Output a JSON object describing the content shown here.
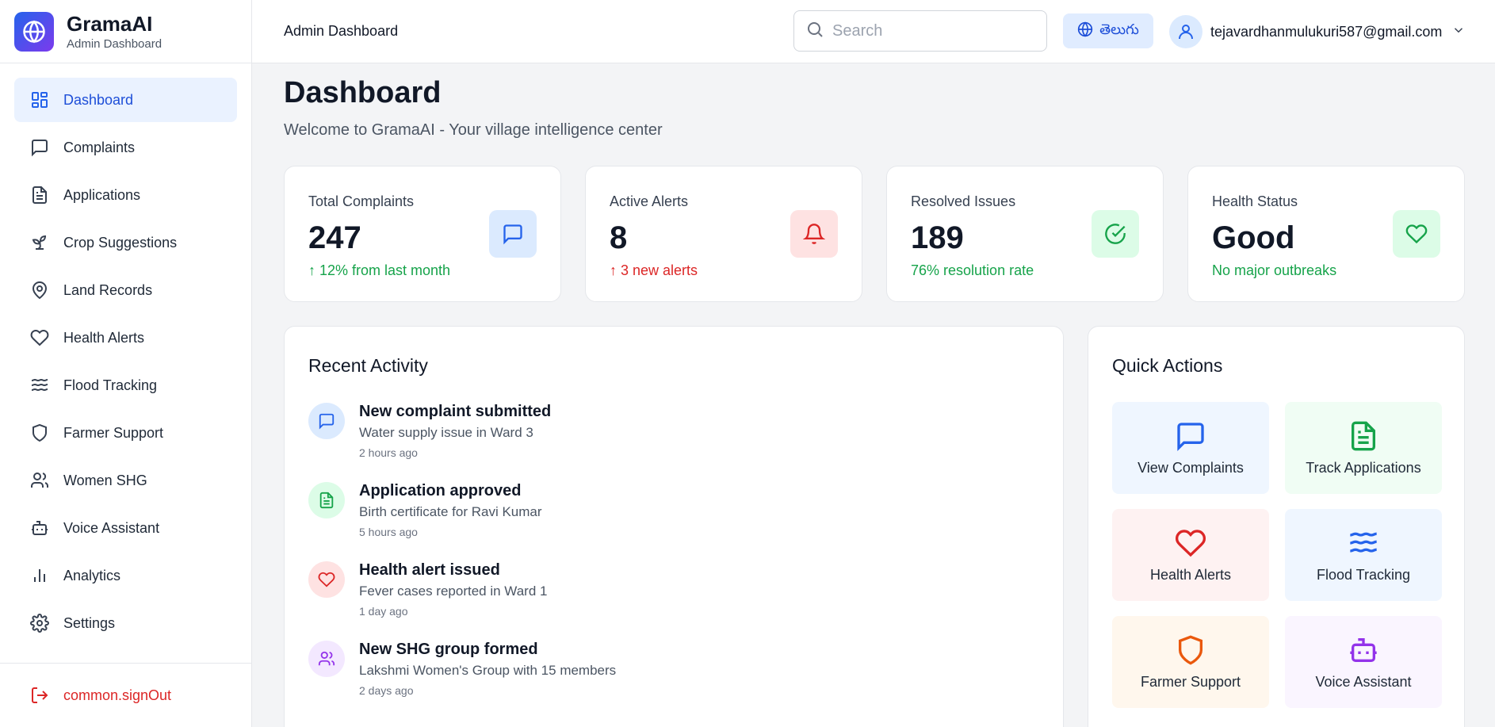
{
  "brand": {
    "name": "GramaAI",
    "subtitle": "Admin Dashboard"
  },
  "sidebar": {
    "items": [
      {
        "label": "Dashboard",
        "icon": "layout-grid-icon",
        "active": true
      },
      {
        "label": "Complaints",
        "icon": "message-square-icon"
      },
      {
        "label": "Applications",
        "icon": "file-text-icon"
      },
      {
        "label": "Crop Suggestions",
        "icon": "sprout-icon"
      },
      {
        "label": "Land Records",
        "icon": "map-pin-icon"
      },
      {
        "label": "Health Alerts",
        "icon": "heart-icon"
      },
      {
        "label": "Flood Tracking",
        "icon": "waves-icon"
      },
      {
        "label": "Farmer Support",
        "icon": "shield-icon"
      },
      {
        "label": "Women SHG",
        "icon": "users-icon"
      },
      {
        "label": "Voice Assistant",
        "icon": "bot-icon"
      },
      {
        "label": "Analytics",
        "icon": "bar-chart-icon"
      },
      {
        "label": "Settings",
        "icon": "gear-icon"
      }
    ],
    "signout_label": "common.signOut"
  },
  "header": {
    "title": "Admin Dashboard",
    "search_placeholder": "Search",
    "language": "తెలుగు",
    "user_email": "tejavardhanmulukuri587@gmail.com"
  },
  "main": {
    "title": "Dashboard",
    "subtitle": "Welcome to GramaAI - Your village intelligence center"
  },
  "stats": [
    {
      "label": "Total Complaints",
      "value": "247",
      "note": "↑ 12% from last month",
      "note_color": "#16a34a",
      "icon": "message-square-icon",
      "icon_bg": "#dbeafe",
      "icon_color": "#2563eb"
    },
    {
      "label": "Active Alerts",
      "value": "8",
      "note": "↑ 3 new alerts",
      "note_color": "#dc2626",
      "icon": "bell-icon",
      "icon_bg": "#fee2e2",
      "icon_color": "#dc2626"
    },
    {
      "label": "Resolved Issues",
      "value": "189",
      "note": "76% resolution rate",
      "note_color": "#16a34a",
      "icon": "check-circle-icon",
      "icon_bg": "#dcfce7",
      "icon_color": "#16a34a"
    },
    {
      "label": "Health Status",
      "value": "Good",
      "note": "No major outbreaks",
      "note_color": "#16a34a",
      "icon": "heart-icon",
      "icon_bg": "#dcfce7",
      "icon_color": "#16a34a"
    }
  ],
  "recent_activity": {
    "title": "Recent Activity",
    "items": [
      {
        "title": "New complaint submitted",
        "desc": "Water supply issue in Ward 3",
        "time": "2 hours ago",
        "icon": "message-square-icon"
      },
      {
        "title": "Application approved",
        "desc": "Birth certificate for Ravi Kumar",
        "time": "5 hours ago",
        "icon": "file-text-icon"
      },
      {
        "title": "Health alert issued",
        "desc": "Fever cases reported in Ward 1",
        "time": "1 day ago",
        "icon": "heart-icon"
      },
      {
        "title": "New SHG group formed",
        "desc": "Lakshmi Women's Group with 15 members",
        "time": "2 days ago",
        "icon": "users-icon"
      }
    ]
  },
  "quick_actions": {
    "title": "Quick Actions",
    "items": [
      {
        "label": "View Complaints",
        "icon": "message-square-icon"
      },
      {
        "label": "Track Applications",
        "icon": "file-text-icon"
      },
      {
        "label": "Health Alerts",
        "icon": "heart-icon"
      },
      {
        "label": "Flood Tracking",
        "icon": "waves-icon"
      },
      {
        "label": "Farmer Support",
        "icon": "shield-icon"
      },
      {
        "label": "Voice Assistant",
        "icon": "bot-icon"
      }
    ]
  },
  "colors": {
    "accent": "#2563eb",
    "danger": "#dc2626",
    "success": "#16a34a",
    "purple": "#9333ea",
    "orange": "#ea580c"
  }
}
